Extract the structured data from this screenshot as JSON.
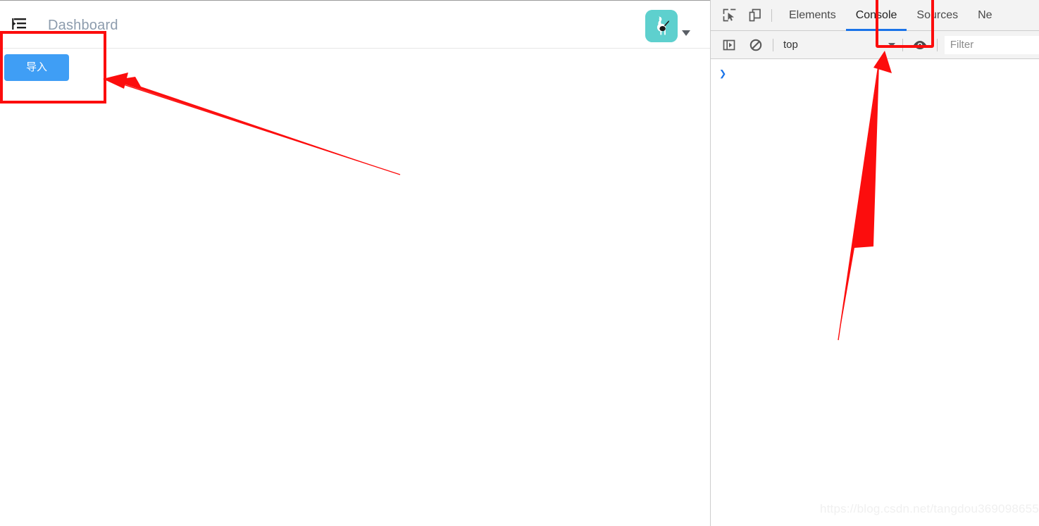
{
  "page": {
    "menu_icon": "menu-fold-icon",
    "title": "Dashboard",
    "avatar_icon": "cat-avatar-icon",
    "avatar_caret_icon": "caret-down-icon",
    "import_button_label": "导入"
  },
  "devtools": {
    "inspect_icon": "inspect-element-icon",
    "device_icon": "device-toolbar-icon",
    "tabs": [
      {
        "label": "Elements",
        "active": false
      },
      {
        "label": "Console",
        "active": true
      },
      {
        "label": "Sources",
        "active": false
      },
      {
        "label": "Ne",
        "active": false
      }
    ],
    "toolbar": {
      "sidebar_icon": "console-sidebar-icon",
      "clear_icon": "clear-console-icon",
      "context_value": "top",
      "context_caret_icon": "caret-down-icon",
      "eye_icon": "live-expression-eye-icon",
      "filter_placeholder": "Filter",
      "filter_value": ""
    },
    "console": {
      "prompt": "❯"
    }
  },
  "watermark": {
    "text": "https://blog.csdn.net/tangdou369098655"
  },
  "annotations": {
    "import_box_label": "highlight-import-button",
    "console_box_label": "highlight-console-tab",
    "arrow_to_import_label": "arrow-pointing-to-import",
    "arrow_to_console_label": "arrow-pointing-to-console"
  },
  "colors": {
    "primary_blue": "#3f9ef5",
    "annotation_red": "#fc0d0d",
    "devtools_accent": "#1a73e8",
    "avatar_teal": "#5ed0ce"
  }
}
